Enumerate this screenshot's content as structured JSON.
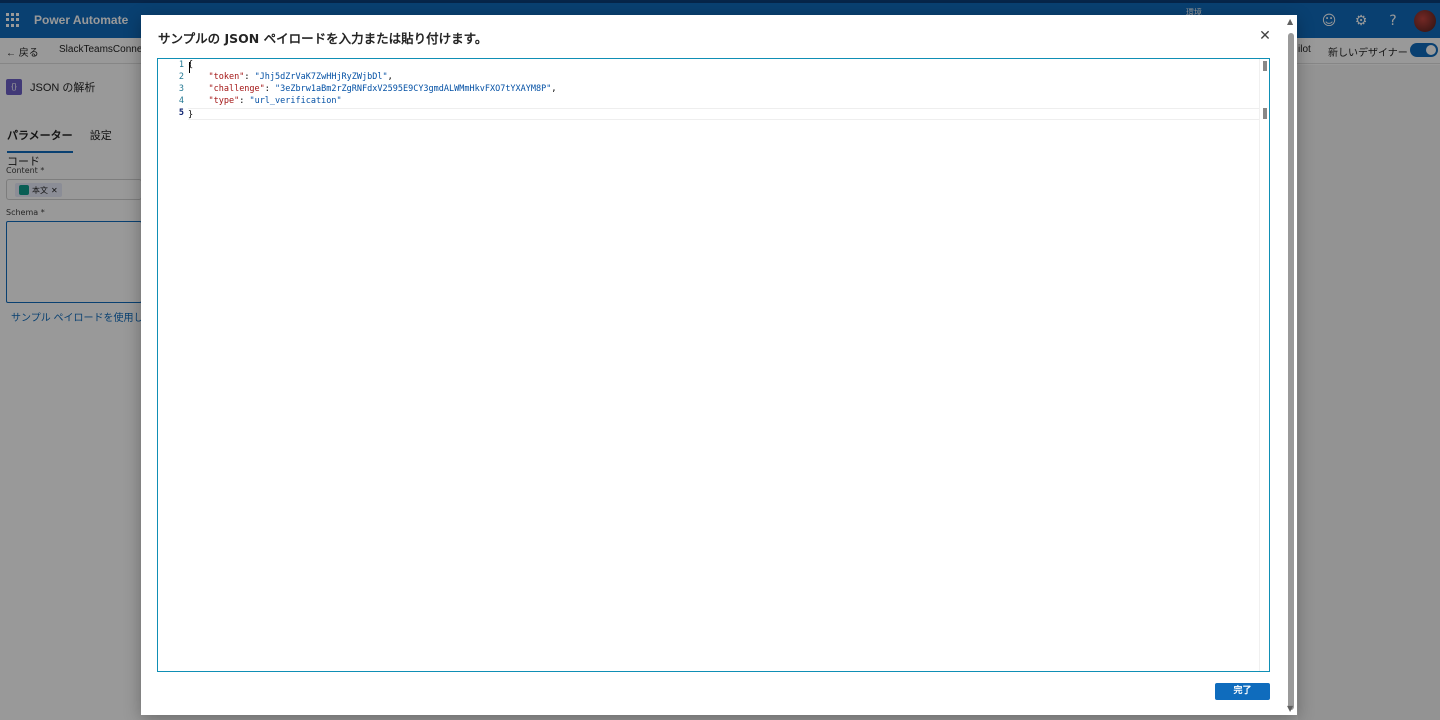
{
  "app": {
    "brand": "Power Automate",
    "environment": "環境",
    "back_label": "戻る",
    "flow_name": "SlackTeamsConnect",
    "copilot_label": "ilot",
    "new_designer_label": "新しいデザイナー"
  },
  "left_panel": {
    "action_title": "JSON の解析",
    "tabs": [
      "パラメーター",
      "設定",
      "コード"
    ],
    "content_label": "Content *",
    "content_chip": "本文",
    "schema_label": "Schema *",
    "sample_link": "サンプル ペイロードを使用して"
  },
  "dialog": {
    "title": "サンプルの JSON ペイロードを入力または貼り付けます。",
    "done_label": "完了",
    "editor": {
      "line_numbers": [
        "1",
        "2",
        "3",
        "4",
        "5"
      ],
      "lines": {
        "l1": "{",
        "l2_key": "\"token\"",
        "l2_sep": ": ",
        "l2_val": "\"Jhj5dZrVaK7ZwHHjRyZWjbDl\"",
        "l2_end": ",",
        "l3_key": "\"challenge\"",
        "l3_sep": ": ",
        "l3_val": "\"3eZbrw1aBm2rZgRNFdxV2595E9CY3gmdALWMmHkvFXO7tYXAYM8P\"",
        "l3_end": ",",
        "l4_key": "\"type\"",
        "l4_sep": ": ",
        "l4_val": "\"url_verification\"",
        "l5": "}"
      }
    }
  },
  "icons": [
    "waffle-icon",
    "back-arrow-icon",
    "smiley-icon",
    "gear-icon",
    "help-icon",
    "close-icon",
    "scroll-up-icon",
    "scroll-down-icon"
  ],
  "colors": {
    "brand": "#0f6cbd",
    "json_key": "#a31515",
    "json_string": "#0451a5",
    "line_number": "#237893"
  }
}
